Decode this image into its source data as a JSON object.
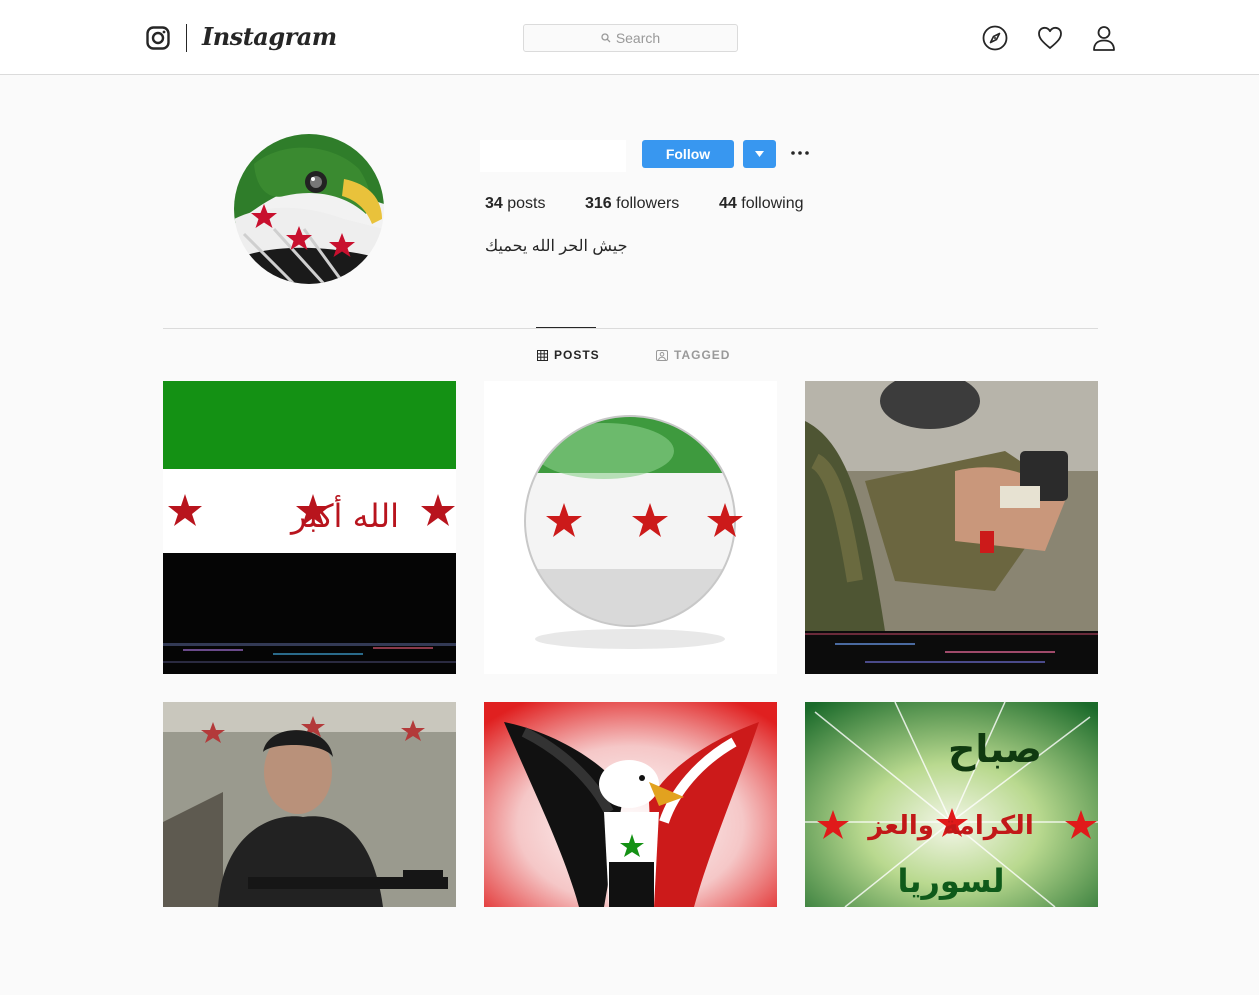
{
  "header": {
    "brand": "Instagram",
    "search_placeholder": "Search",
    "icons": [
      "instagram-logo-icon",
      "explore-compass-icon",
      "activity-heart-icon",
      "profile-person-icon"
    ]
  },
  "profile": {
    "username": "",
    "follow_label": "Follow",
    "stats": {
      "posts_count": "34",
      "posts_label": "posts",
      "followers_count": "316",
      "followers_label": "followers",
      "following_count": "44",
      "following_label": "following"
    },
    "bio": "جيش الحر الله يحميك"
  },
  "tabs": [
    {
      "label": "POSTS",
      "active": true
    },
    {
      "label": "TAGGED",
      "active": false
    }
  ],
  "posts": {
    "p1": {
      "text": "الله أكبر"
    },
    "p6": {
      "line1": "صباح",
      "line2": "الكرامة والعز",
      "line3": "لسوريا"
    }
  },
  "colors": {
    "accent_blue": "#3897f0",
    "flag_green": "#149114",
    "flag_red": "#ce1126",
    "flag_black": "#000000"
  }
}
